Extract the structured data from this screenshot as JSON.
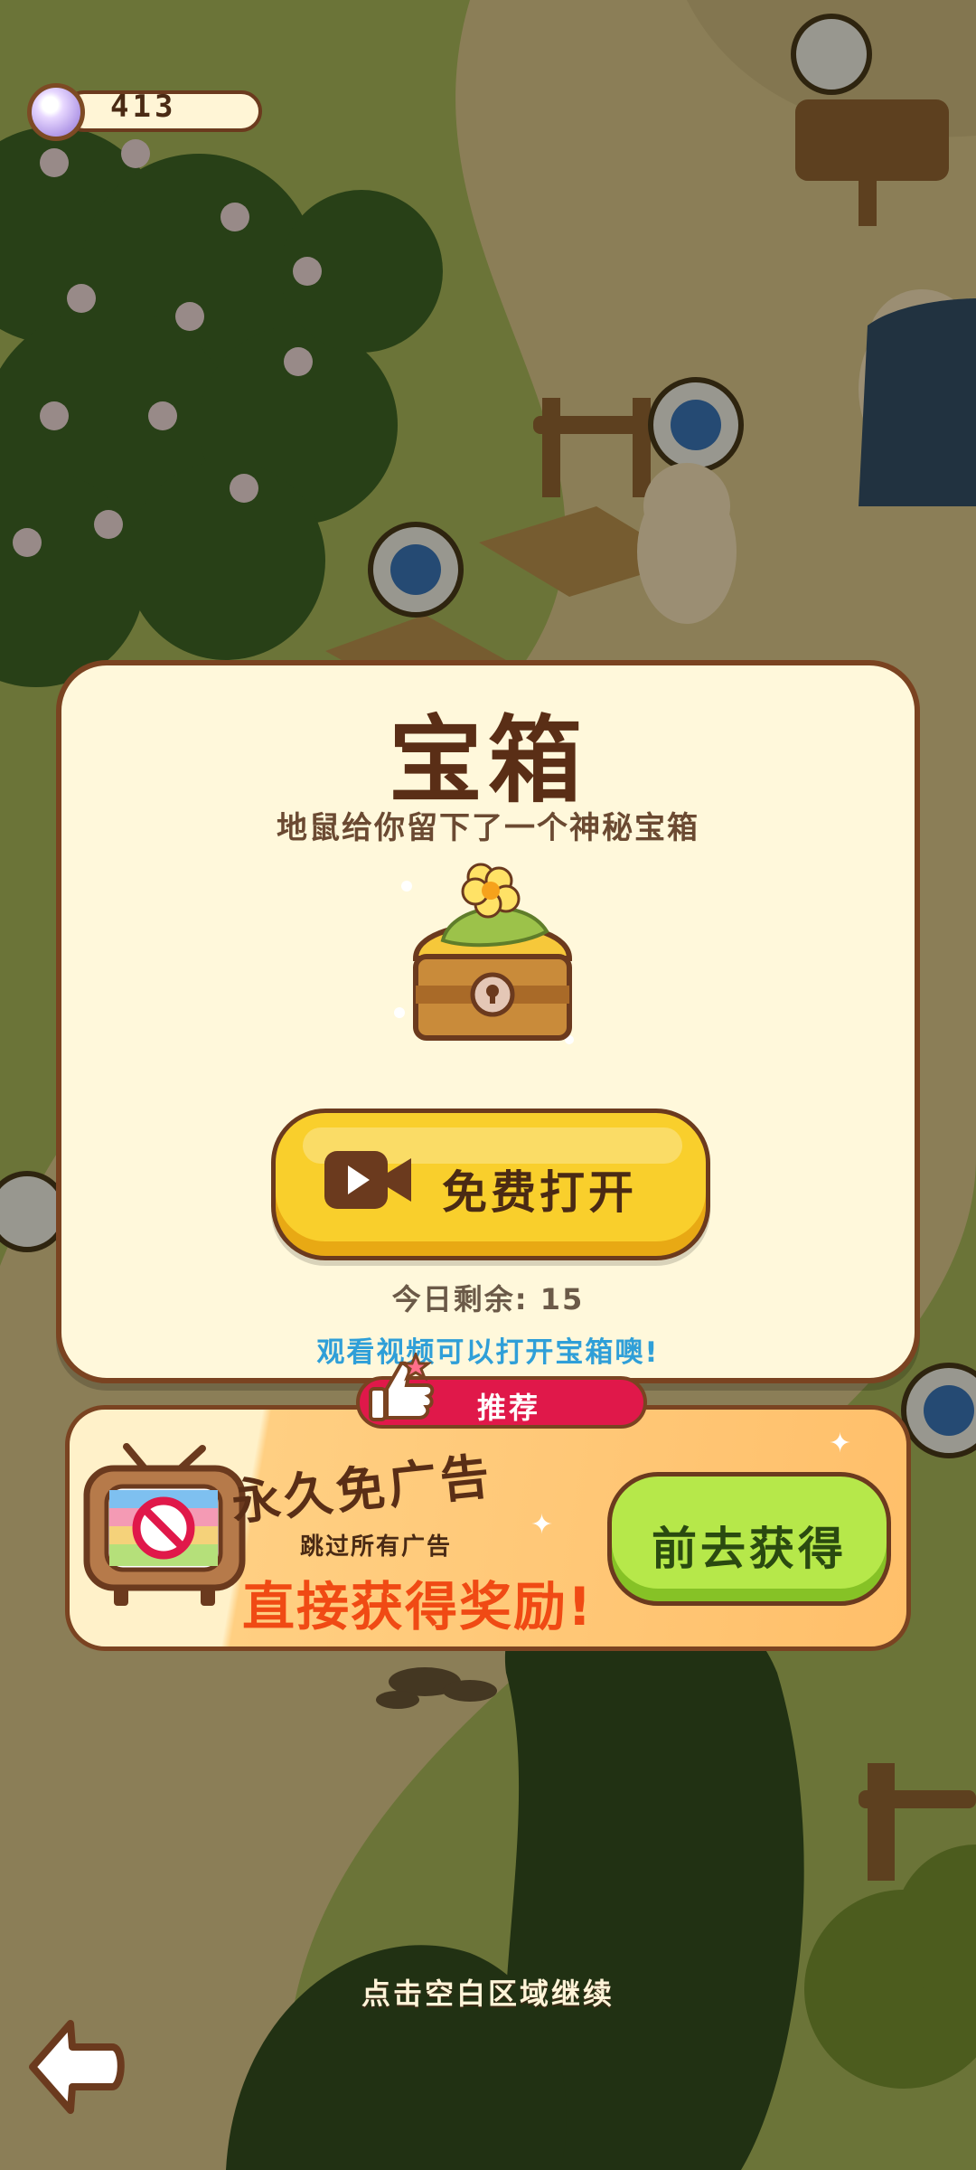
{
  "hud": {
    "currency_icon": "pearl-icon",
    "currency_value": "413"
  },
  "dialog": {
    "title": "宝箱",
    "subtitle": "地鼠给你留下了一个神秘宝箱",
    "chest_icon": "treasure-chest-icon",
    "open_button_icon": "video-camera-icon",
    "open_button_label": "免费打开",
    "remaining_text": "今日剩余: 15",
    "hint_text": "观看视频可以打开宝箱噢!"
  },
  "promo": {
    "tab_label": "推荐",
    "tab_icon": "thumbs-up-icon",
    "tv_icon": "no-ads-tv-icon",
    "title": "永久免广告",
    "subtitle": "跳过所有广告",
    "headline": "直接获得奖励!",
    "button_label": "前去获得"
  },
  "footer": {
    "continue_hint": "点击空白区域继续",
    "back_icon": "back-arrow-icon"
  },
  "colors": {
    "dialog_bg": "#fff8db",
    "border_brown": "#7a4321",
    "open_button_yellow": "#f9cf2c",
    "get_button_green": "#b6e84a",
    "tab_red": "#e0184a",
    "hint_blue": "#2f9fd8",
    "headline_orange": "#f04a14"
  }
}
